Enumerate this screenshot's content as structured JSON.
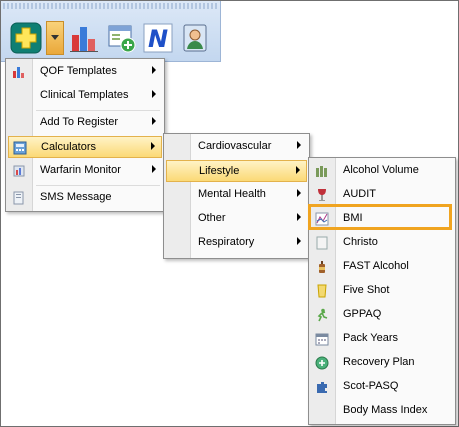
{
  "colors": {
    "menu_bg": "#fafafa",
    "hover": "#fbd976",
    "highlight": "#f0a420"
  },
  "toolbar": {
    "buttons": [
      {
        "icon": "add-plus-icon"
      },
      {
        "icon": "dropdown-arrow-icon"
      },
      {
        "icon": "bar-chart-icon"
      },
      {
        "icon": "form-add-icon"
      },
      {
        "icon": "n-logo-icon"
      },
      {
        "icon": "person-book-icon"
      }
    ]
  },
  "menu1": {
    "items": [
      {
        "label": "QOF Templates"
      },
      {
        "label": "Clinical Templates"
      },
      {
        "label": "Add To Register"
      },
      {
        "label": "Calculators"
      },
      {
        "label": "Warfarin Monitor"
      },
      {
        "label": "SMS Message"
      }
    ]
  },
  "menu2": {
    "items": [
      {
        "label": "Cardiovascular"
      },
      {
        "label": "Lifestyle"
      },
      {
        "label": "Mental Health"
      },
      {
        "label": "Other"
      },
      {
        "label": "Respiratory"
      }
    ]
  },
  "menu3": {
    "items": [
      {
        "label": "Alcohol Volume"
      },
      {
        "label": "AUDIT"
      },
      {
        "label": "BMI"
      },
      {
        "label": "Christo"
      },
      {
        "label": "FAST Alcohol"
      },
      {
        "label": "Five Shot"
      },
      {
        "label": "GPPAQ"
      },
      {
        "label": "Pack Years"
      },
      {
        "label": "Recovery Plan"
      },
      {
        "label": "Scot-PASQ"
      },
      {
        "label": "Body Mass Index"
      }
    ]
  }
}
